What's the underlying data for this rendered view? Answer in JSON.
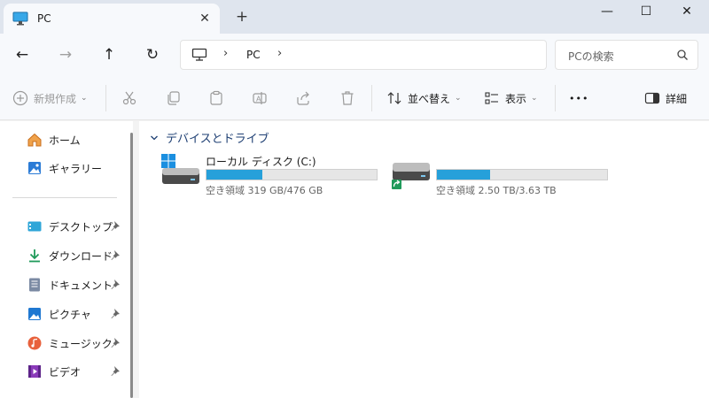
{
  "tab": {
    "title": "PC",
    "close": "✕",
    "new_tab": "+"
  },
  "window": {
    "minimize": "—",
    "maximize": "☐",
    "close": "✕"
  },
  "nav": {
    "back": "←",
    "forward": "→",
    "up": "↑",
    "refresh": "↻",
    "breadcrumb": {
      "sep1": "›",
      "current": "PC",
      "sep2": "›"
    },
    "search_placeholder": "PCの検索"
  },
  "commands": {
    "new": "新規作成",
    "sort": "並べ替え",
    "view": "表示",
    "more": "•••",
    "details": "詳細"
  },
  "sidebar": {
    "home": "ホーム",
    "gallery": "ギャラリー",
    "pinned": [
      {
        "label": "デスクトップ"
      },
      {
        "label": "ダウンロード"
      },
      {
        "label": "ドキュメント"
      },
      {
        "label": "ピクチャ"
      },
      {
        "label": "ミュージック"
      },
      {
        "label": "ビデオ"
      }
    ]
  },
  "main": {
    "group_title": "デバイスとドライブ",
    "drives": [
      {
        "name": "ローカル ディスク (C:)",
        "free_text": "空き領域 319 GB/476 GB",
        "used_fraction": 0.33
      },
      {
        "name": "",
        "free_text": "空き領域 2.50 TB/3.63 TB",
        "used_fraction": 0.31
      }
    ]
  },
  "colors": {
    "accent": "#26a0da",
    "group_heading": "#1e3f73"
  }
}
